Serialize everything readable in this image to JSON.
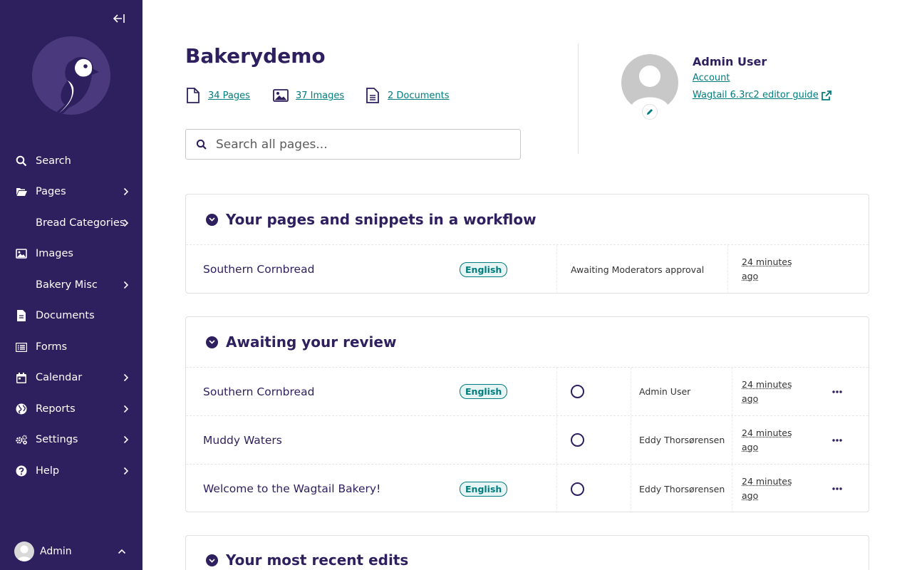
{
  "sidebar": {
    "collapse_label": "←",
    "items": [
      {
        "label": "Search"
      },
      {
        "label": "Pages"
      },
      {
        "label": "Bread Categories"
      },
      {
        "label": "Images"
      },
      {
        "label": "Bakery Misc"
      },
      {
        "label": "Documents"
      },
      {
        "label": "Forms"
      },
      {
        "label": "Calendar"
      },
      {
        "label": "Reports"
      },
      {
        "label": "Settings"
      },
      {
        "label": "Help"
      }
    ],
    "user_label": "Admin"
  },
  "header": {
    "site_title": "Bakerydemo",
    "stats": {
      "pages": "34 Pages",
      "images": "37 Images",
      "documents": "2 Documents"
    },
    "search_placeholder": "Search all pages..."
  },
  "user_panel": {
    "name": "Admin User",
    "account_link": "Account",
    "guide_link": "Wagtail 6.3rc2 editor guide"
  },
  "panels": {
    "workflow": {
      "title": "Your pages and snippets in a workflow",
      "rows": [
        {
          "title": "Southern Cornbread",
          "locale": "English",
          "status": "Awaiting Moderators approval",
          "time": "24 minutes ago"
        }
      ]
    },
    "review": {
      "title": "Awaiting your review",
      "rows": [
        {
          "title": "Southern Cornbread",
          "locale": "English",
          "user": "Admin User",
          "time": "24 minutes ago"
        },
        {
          "title": "Muddy Waters",
          "locale": "",
          "user": "Eddy Thorsørensen",
          "time": "24 minutes ago"
        },
        {
          "title": "Welcome to the Wagtail Bakery!",
          "locale": "English",
          "user": "Eddy Thorsørensen",
          "time": "24 minutes ago"
        }
      ]
    },
    "recent": {
      "title": "Your most recent edits"
    }
  },
  "colors": {
    "sidebar_bg": "#2e1f5e",
    "link_teal": "#007d7e",
    "heading": "#2e1f5e"
  }
}
